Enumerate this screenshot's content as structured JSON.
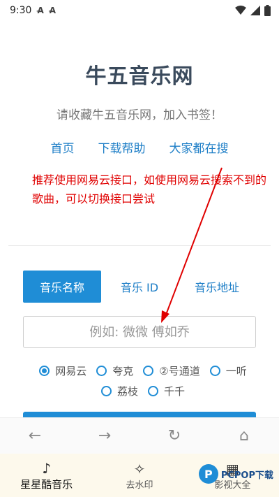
{
  "status_bar": {
    "time": "9:30",
    "icons": [
      "a-icon",
      "a-icon",
      "wifi-icon",
      "signal-icon",
      "battery-icon"
    ]
  },
  "header": {
    "title": "牛五音乐网",
    "subtitle": "请收藏牛五音乐网，加入书签！"
  },
  "nav": {
    "links": [
      "首页",
      "下载帮助",
      "大家都在搜"
    ]
  },
  "note": "推荐使用网易云接口，如使用网易云搜索不到的歌曲，可以切换接口尝试",
  "tabs": [
    {
      "label": "音乐名称",
      "active": true
    },
    {
      "label": "音乐 ID",
      "active": false
    },
    {
      "label": "音乐地址",
      "active": false
    }
  ],
  "search": {
    "placeholder": "例如: 微微 傅如乔"
  },
  "sources": {
    "row1": [
      "网易云",
      "夸克",
      "②号通道",
      "一听"
    ],
    "row2": [
      "荔枝",
      "千千"
    ],
    "selected": "网易云"
  },
  "browser_bar": {
    "icons": [
      "back-icon",
      "forward-icon",
      "refresh-icon",
      "home-icon"
    ]
  },
  "bottom_nav": {
    "items": [
      {
        "label": "星星酷音乐",
        "icon": "music-note-icon",
        "active": true
      },
      {
        "label": "去水印",
        "icon": "magic-wand-icon",
        "active": false
      },
      {
        "label": "影视大全",
        "icon": "film-icon",
        "active": false
      }
    ]
  },
  "watermark": {
    "logo": "P",
    "text": "PCPOP下载"
  },
  "colors": {
    "accent": "#1f8dd6",
    "link": "#1f7fc7",
    "note": "#e00000",
    "title": "#3a4a5c"
  }
}
